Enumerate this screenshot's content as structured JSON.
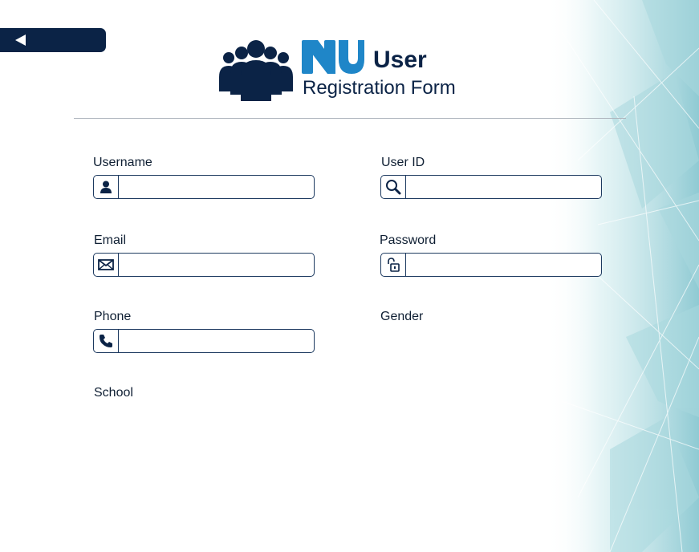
{
  "nav": {
    "back_icon": "back-arrow-icon"
  },
  "header": {
    "icon": "people-group-icon",
    "logo": "NU",
    "title": "User",
    "subtitle": "Registration Form"
  },
  "form": {
    "username": {
      "label": "Username",
      "icon": "person-icon",
      "value": "",
      "placeholder": ""
    },
    "user_id": {
      "label": "User ID",
      "icon": "magnifier-icon",
      "value": "",
      "placeholder": ""
    },
    "email": {
      "label": "Email",
      "icon": "envelope-icon",
      "value": "",
      "placeholder": ""
    },
    "password": {
      "label": "Password",
      "icon": "unlock-icon",
      "value": "",
      "placeholder": ""
    },
    "phone": {
      "label": "Phone",
      "icon": "phone-icon",
      "value": "",
      "placeholder": ""
    },
    "gender": {
      "label": "Gender"
    },
    "school": {
      "label": "School"
    }
  },
  "colors": {
    "navy": "#0b2346",
    "brand_blue": "#1f86c8",
    "teal_bg": "#b7dfe4",
    "field_border": "#1d3a60"
  }
}
